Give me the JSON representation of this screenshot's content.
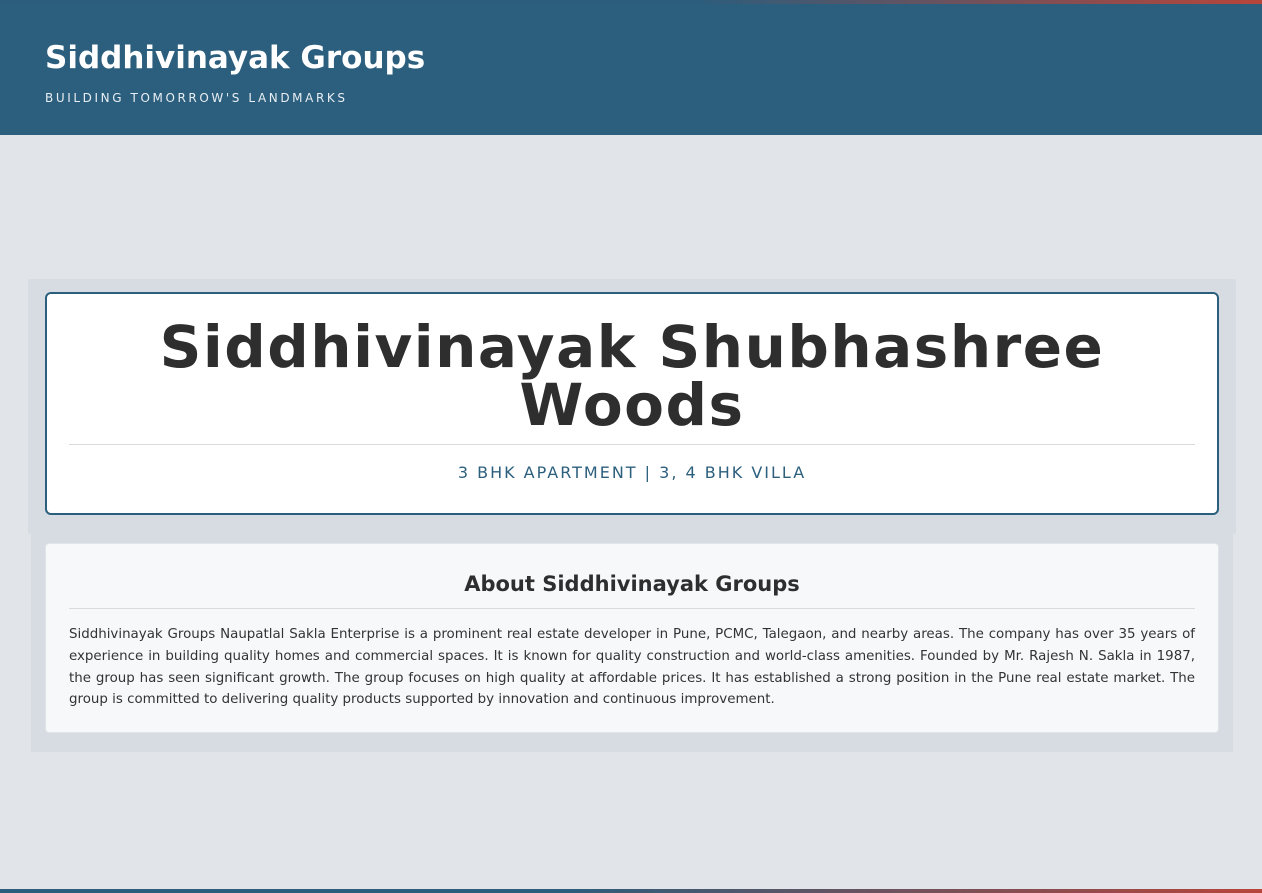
{
  "header": {
    "site_title": "Siddhivinayak Groups",
    "tagline": "BUILDING TOMORROW'S LANDMARKS"
  },
  "hero": {
    "project_title": "Siddhivinayak Shubhashree Woods",
    "configuration": "3 BHK APARTMENT | 3, 4 BHK VILLA"
  },
  "about": {
    "heading": "About Siddhivinayak Groups",
    "body": "Siddhivinayak Groups Naupatlal Sakla Enterprise is a prominent real estate developer in Pune, PCMC, Talegaon, and nearby areas. The company has over 35 years of experience in building quality homes and commercial spaces. It is known for quality construction and world-class amenities. Founded by Mr. Rajesh N. Sakla in 1987, the group has seen significant growth. The group focuses on high quality at affordable prices. It has established a strong position in the Pune real estate market. The group is committed to delivering quality products supported by innovation and continuous improvement."
  },
  "colors": {
    "header_bg": "#2c5f7d",
    "accent_red": "#b8453a",
    "page_bg": "#e1e5ea"
  }
}
